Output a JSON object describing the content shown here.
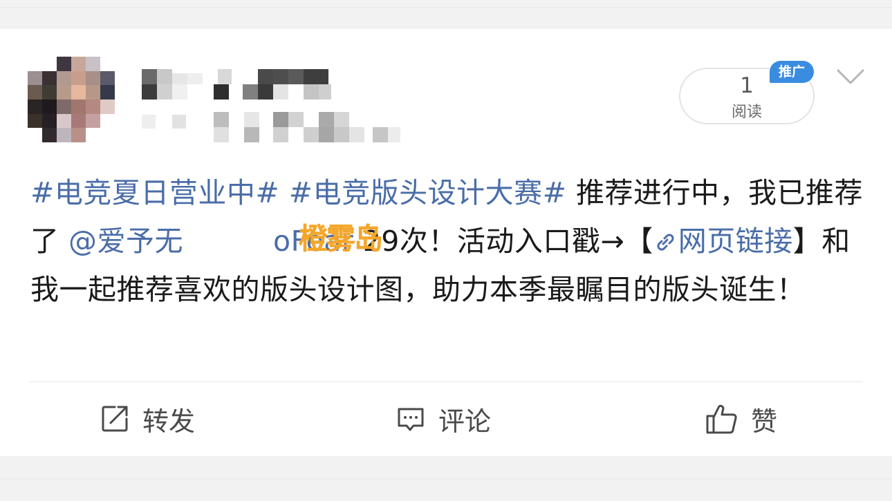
{
  "post": {
    "read_count": "1",
    "read_label": "阅读",
    "promo_badge": "推广",
    "text": {
      "hashtag1": "#电竞夏日营业中#",
      "hashtag2": "#电竞版头设计大赛#",
      "seg1": " 推荐进行中，我已推荐了 ",
      "mention": "@爱予无",
      "mention_tail": "oFear",
      "seg2": " 29次！活动入口戳→【",
      "link": "网页链接",
      "seg3": "】和我一起推荐喜欢的版头设计图，助力本季最瞩目的版头诞生！"
    },
    "watermark": "橙雾岛"
  },
  "actions": {
    "repost": "转发",
    "comment": "评论",
    "like": "赞"
  },
  "icons": {
    "repost": "share-box-icon",
    "comment": "comment-bubble-icon",
    "like": "thumbs-up-icon",
    "link": "link-icon",
    "more": "chevron-down-icon"
  },
  "colors": {
    "link": "#4a6da8",
    "badge": "#3a8ce0",
    "watermark": "#f4a62a"
  }
}
